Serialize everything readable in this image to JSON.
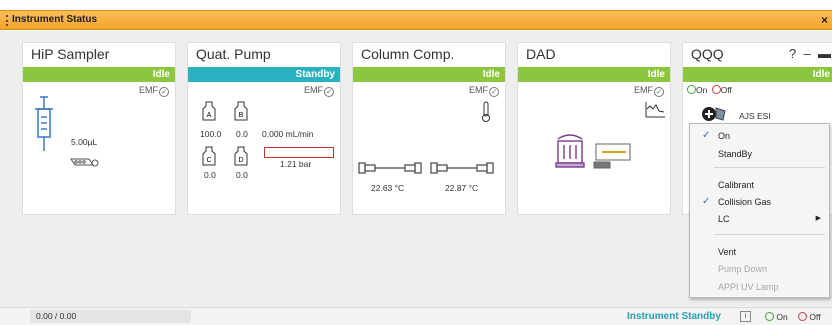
{
  "window": {
    "title": "Instrument Status"
  },
  "modules": [
    {
      "name": "HiP Sampler",
      "state": "Idle",
      "emf": "EMF",
      "volume": "5.00µL"
    },
    {
      "name": "Quat. Pump",
      "state": "Standby",
      "emf": "EMF",
      "bottles": [
        {
          "label": "A",
          "value": "100.0"
        },
        {
          "label": "B",
          "value": "0.0"
        },
        {
          "label": "C",
          "value": "0.0"
        },
        {
          "label": "D",
          "value": "0.0"
        }
      ],
      "flow": "0.000 mL/min",
      "pressure": "1.21 bar"
    },
    {
      "name": "Column Comp.",
      "state": "Idle",
      "emf": "EMF",
      "temp_left": "22.63 °C",
      "temp_right": "22.87 °C"
    },
    {
      "name": "DAD",
      "state": "Idle",
      "emf": "EMF"
    },
    {
      "name": "QQQ",
      "state": "Idle",
      "help": "?",
      "on_label": "On",
      "off_label": "Off",
      "source": "AJS ESI"
    }
  ],
  "context_menu": [
    {
      "label": "On",
      "checked": true,
      "enabled": true
    },
    {
      "label": "StandBy",
      "checked": false,
      "enabled": true
    },
    {
      "label": "Calibrant",
      "checked": false,
      "enabled": true
    },
    {
      "label": "Collision Gas",
      "checked": true,
      "enabled": true
    },
    {
      "label": "LC",
      "checked": false,
      "enabled": true,
      "submenu": true
    },
    {
      "label": "Vent",
      "checked": false,
      "enabled": true
    },
    {
      "label": "Pump Down",
      "checked": false,
      "enabled": false
    },
    {
      "label": "APPI UV Lamp",
      "checked": false,
      "enabled": false
    }
  ],
  "statusbar": {
    "progress": "0.00 / 0.00",
    "status": "Instrument Standby",
    "info": "i",
    "on_label": "On",
    "off_label": "Off"
  },
  "colors": {
    "title_bar": "#f4a42a",
    "idle": "#8cc63f",
    "standby": "#2ab2c0",
    "menu_check": "#2f6fb8"
  }
}
